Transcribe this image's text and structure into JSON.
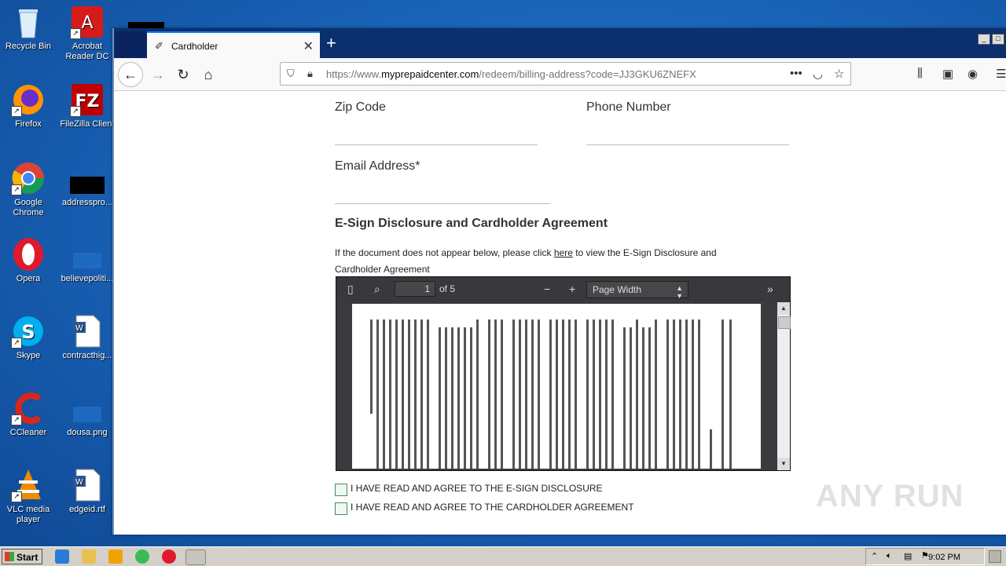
{
  "desktop": {
    "icons": [
      {
        "label": "Recycle Bin"
      },
      {
        "label": "Acrobat Reader DC"
      },
      {
        "label": "Firefox"
      },
      {
        "label": "FileZilla Client"
      },
      {
        "label": "Google Chrome"
      },
      {
        "label": "addresspro..."
      },
      {
        "label": "Opera"
      },
      {
        "label": "believepoliti..."
      },
      {
        "label": "Skype"
      },
      {
        "label": "contracthig..."
      },
      {
        "label": "CCleaner"
      },
      {
        "label": "dousa.png"
      },
      {
        "label": "VLC media player"
      },
      {
        "label": "edgeid.rtf"
      }
    ]
  },
  "browser": {
    "tab_title": "Cardholder",
    "url_prefix": "https://www.",
    "url_domain": "myprepaidcenter.com",
    "url_path": "/redeem/billing-address?code=JJ3GKU6ZNEFX"
  },
  "form": {
    "zip_label": "Zip Code",
    "phone_label": "Phone Number",
    "email_label": "Email Address*",
    "agreement_heading": "E-Sign Disclosure and Cardholder Agreement",
    "para_before_link": "If the document does not appear below, please click ",
    "para_link": "here",
    "para_after_link": " to view the E-Sign Disclosure and Cardholder Agreement",
    "checkbox_esign": "I HAVE READ AND AGREE TO THE E-SIGN DISCLOSURE",
    "checkbox_cardholder": "I HAVE READ AND AGREE TO THE CARDHOLDER AGREEMENT"
  },
  "pdf_viewer": {
    "current_page": "1",
    "page_count_label": "of 5",
    "zoom": "Page Width"
  },
  "taskbar": {
    "start_label": "Start",
    "clock": "9:02 PM"
  },
  "watermark": "ANY RUN"
}
